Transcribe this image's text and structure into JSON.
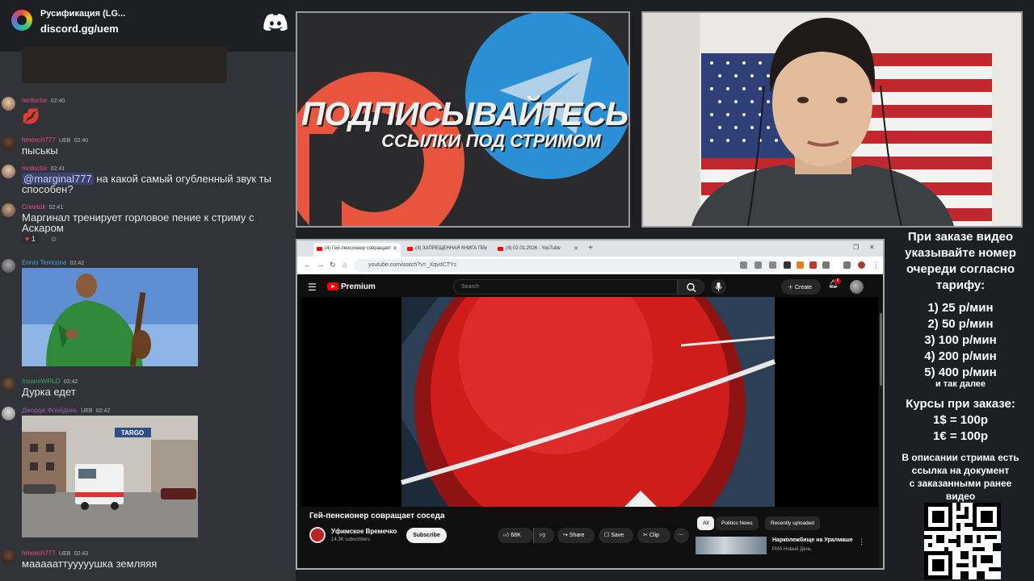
{
  "discord": {
    "server_name": "Русификация (LG...",
    "invite": "discord.gg/uem",
    "messages": [
      {
        "user": "mrdoctor",
        "badges": "",
        "time": "02:40",
        "text": "💋"
      },
      {
        "user": "hmeech777",
        "badges": "UEB",
        "time": "02:40",
        "text": "пыськы"
      },
      {
        "user": "mrdoctor",
        "badges": "",
        "time": "02:41",
        "mention": "@marginal777",
        "text": " на какой самый огубленный звук ты способен?"
      },
      {
        "user": "Crewtok",
        "badges": "",
        "time": "02:41",
        "text": "Маргинал тренирует горловое пение к стриму с Аскаром",
        "reaction_count": "1"
      },
      {
        "user": "Ennio Terricone",
        "badges": "",
        "time": "02:42",
        "text": ""
      },
      {
        "user": "InsaneWRLD",
        "badges": "",
        "time": "02:42",
        "text": "Дурка едет"
      },
      {
        "user": "Джордж Флойдинь",
        "badges": "UEB",
        "time": "02:42",
        "text": ""
      },
      {
        "user": "hmeech777",
        "badges": "UEB",
        "time": "02:43",
        "text": "маааааттууууушка земляяя"
      }
    ],
    "sign_text": "TARGO"
  },
  "promo": {
    "line1": "ПОДПИСЫВАЙТЕСЬ",
    "line2": "ССЫЛКИ ПОД СТРИМОМ"
  },
  "browser": {
    "tabs": [
      {
        "label": "(4) Гей-пенсионер совращает"
      },
      {
        "label": "(4) ЗАПРЕЩЕННАЯ КНИГА ПР"
      },
      {
        "label": "(4) 02.01.2026 - YouTube"
      }
    ],
    "url": "youtube.com/watch?v=_XqvdCTYs"
  },
  "youtube": {
    "brand": "Premium",
    "search_placeholder": "Search",
    "create_label": "Create",
    "notif_count": "9",
    "video_title": "Гей-пенсионер совращает соседа",
    "channel_name": "Уфимское Времечко",
    "channel_subs": "14.3K subscribers",
    "subscribe_label": "Subscribe",
    "likes": "68K",
    "share_label": "Share",
    "save_label": "Save",
    "clip_label": "Clip",
    "chips": [
      "All",
      "Politics News",
      "Recently uploaded"
    ],
    "recommended": {
      "title": "Нарколежбище на Уралмаше",
      "channel": "РИА Новый День"
    }
  },
  "info": {
    "intro": [
      "При заказе видео",
      "указывайте номер",
      "очереди согласно",
      "тарифу:"
    ],
    "tariffs": [
      "1) 25 р/мин",
      "2) 50 р/мин",
      "3) 100 р/мин",
      "4) 200 р/мин",
      "5) 400 р/мин"
    ],
    "etc": "и так далее",
    "rates_title": "Курсы при заказе:",
    "rates": [
      "1$ = 100р",
      "1€ = 100р"
    ],
    "note": [
      "В описании стрима есть",
      "ссылка на документ",
      "с заказанными ранее",
      "видео"
    ]
  },
  "colors": {
    "discord_bg": "#313338",
    "username_pink": "#e94d8a",
    "username_blue": "#4aa3df",
    "username_green": "#3ba55c",
    "youtube_red": "#ff0000"
  }
}
